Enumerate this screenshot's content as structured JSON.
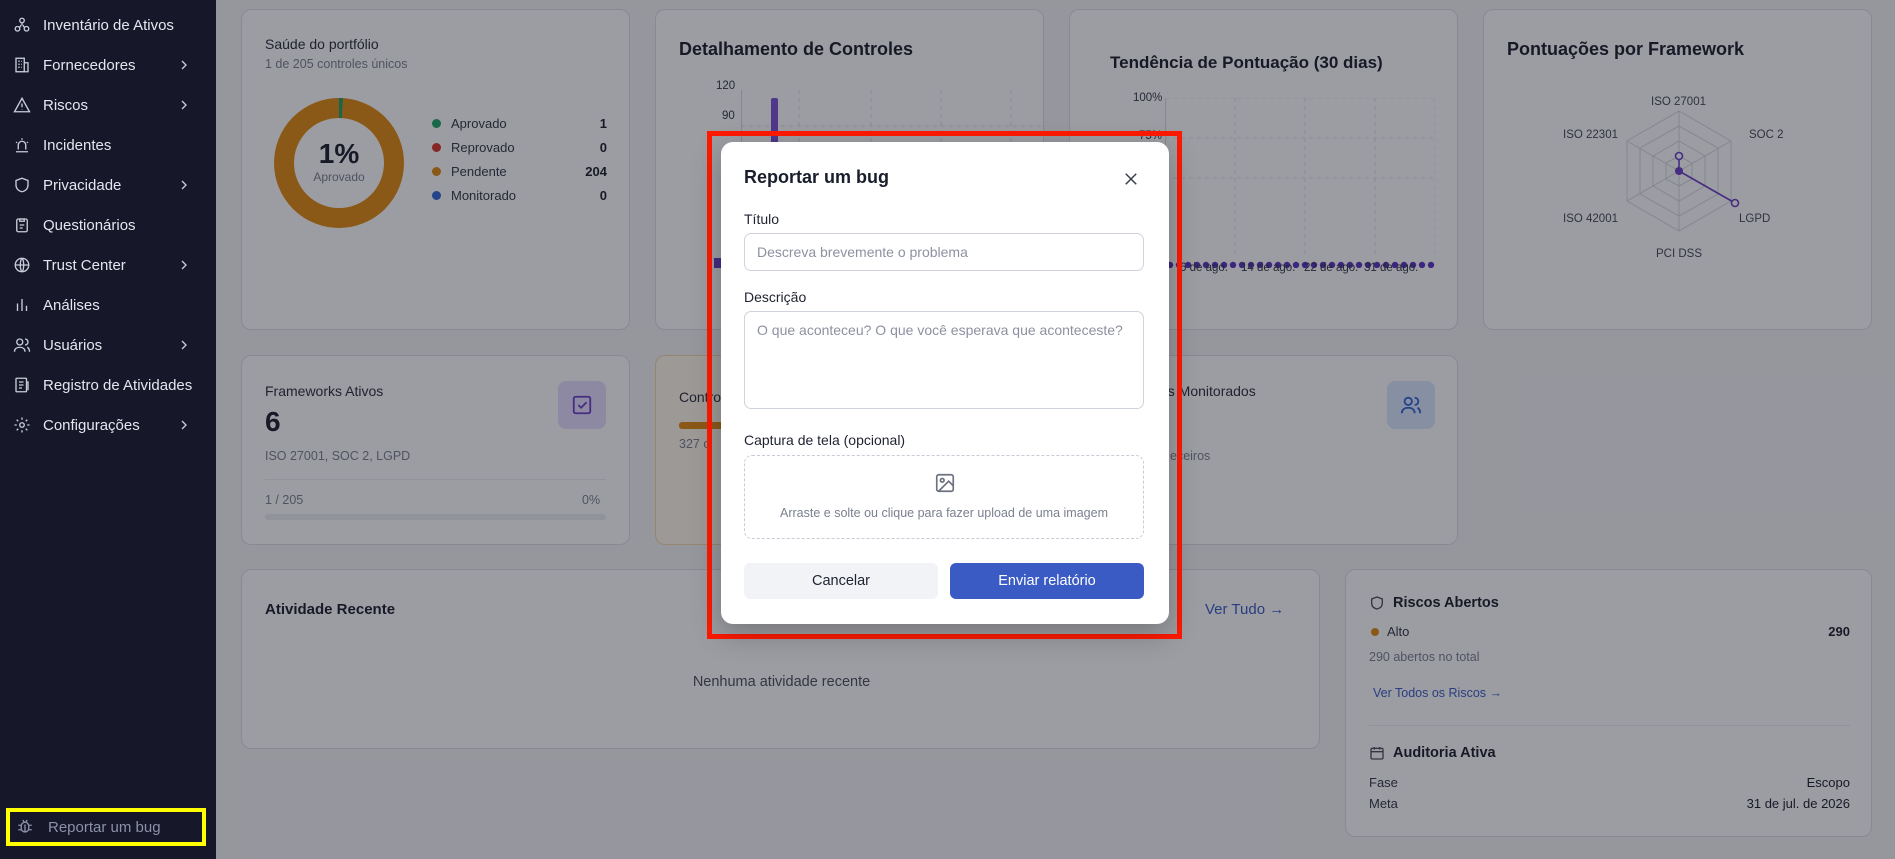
{
  "sidebar": {
    "items": [
      {
        "label": "Inventário de Ativos",
        "icon": "assets-icon",
        "chevron": false
      },
      {
        "label": "Fornecedores",
        "icon": "building-icon",
        "chevron": true
      },
      {
        "label": "Riscos",
        "icon": "warning-icon",
        "chevron": true
      },
      {
        "label": "Incidentes",
        "icon": "siren-icon",
        "chevron": false
      },
      {
        "label": "Privacidade",
        "icon": "shield-icon",
        "chevron": true
      },
      {
        "label": "Questionários",
        "icon": "clipboard-icon",
        "chevron": false
      },
      {
        "label": "Trust Center",
        "icon": "globe-icon",
        "chevron": true
      },
      {
        "label": "Análises",
        "icon": "bar-chart-icon",
        "chevron": false
      },
      {
        "label": "Usuários",
        "icon": "users-icon",
        "chevron": true
      },
      {
        "label": "Registro de Atividades",
        "icon": "log-icon",
        "chevron": false
      },
      {
        "label": "Configurações",
        "icon": "gear-icon",
        "chevron": true
      }
    ],
    "bug_report": "Reportar um bug"
  },
  "portfolio": {
    "title": "Saúde do portfólio",
    "subtitle": "1 de 205 controles únicos",
    "percent": "1%",
    "percent_label": "Aprovado",
    "legend": [
      {
        "label": "Aprovado",
        "value": "1",
        "color": "#1aa266"
      },
      {
        "label": "Reprovado",
        "value": "0",
        "color": "#d8342c"
      },
      {
        "label": "Pendente",
        "value": "204",
        "color": "#e08a12"
      },
      {
        "label": "Monitorado",
        "value": "0",
        "color": "#2f64d6"
      }
    ]
  },
  "controls": {
    "title": "Detalhamento de Controles",
    "ticks": [
      "120",
      "90"
    ]
  },
  "trend": {
    "title": "Tendência de Pontuação (30 dias)",
    "ytick": "100%",
    "ytick2": "75%",
    "xticks": [
      "6 de ago.",
      "14 de ago.",
      "22 de ago.",
      "31 de ago."
    ]
  },
  "frameworks_radar": {
    "title": "Pontuações por Framework",
    "axes": [
      "ISO 27001",
      "SOC 2",
      "LGPD",
      "PCI DSS",
      "ISO 42001",
      "ISO 22301"
    ]
  },
  "active_frameworks": {
    "title": "Frameworks Ativos",
    "count": "6",
    "list": "ISO 27001, SOC 2, LGPD",
    "progress_label": "1 / 205",
    "progress_pct": "0%"
  },
  "controls_card": {
    "title_partial": "Contro",
    "sub_partial": "327 c",
    "progress": 0.4
  },
  "monitored": {
    "title_partial": "es Monitorados",
    "sub_partial": "eceiros"
  },
  "activity": {
    "title": "Atividade Recente",
    "see_all": "Ver Tudo →",
    "empty": "Nenhuma atividade recente"
  },
  "risks": {
    "title": "Riscos Abertos",
    "level": "Alto",
    "level_count": "290",
    "total": "290 abertos no total",
    "link": "Ver Todos os Riscos →"
  },
  "audit": {
    "title": "Auditoria Ativa",
    "phase_label": "Fase",
    "phase_value": "Escopo",
    "goal_label": "Meta",
    "goal_value": "31 de jul. de 2026"
  },
  "modal": {
    "title": "Reportar um bug",
    "title_label": "Título",
    "title_placeholder": "Descreva brevemente o problema",
    "desc_label": "Descrição",
    "desc_placeholder": "O que aconteceu? O que você esperava que aconteceste?",
    "screenshot_label": "Captura de tela (opcional)",
    "drop_text": "Arraste e solte ou clique para fazer upload de uma imagem",
    "cancel": "Cancelar",
    "submit": "Enviar relatório"
  },
  "colors": {
    "sidebar_bg": "#16182a",
    "accent": "#3b5bc4",
    "pending": "#e08a12",
    "purple": "#6a3fc9"
  }
}
